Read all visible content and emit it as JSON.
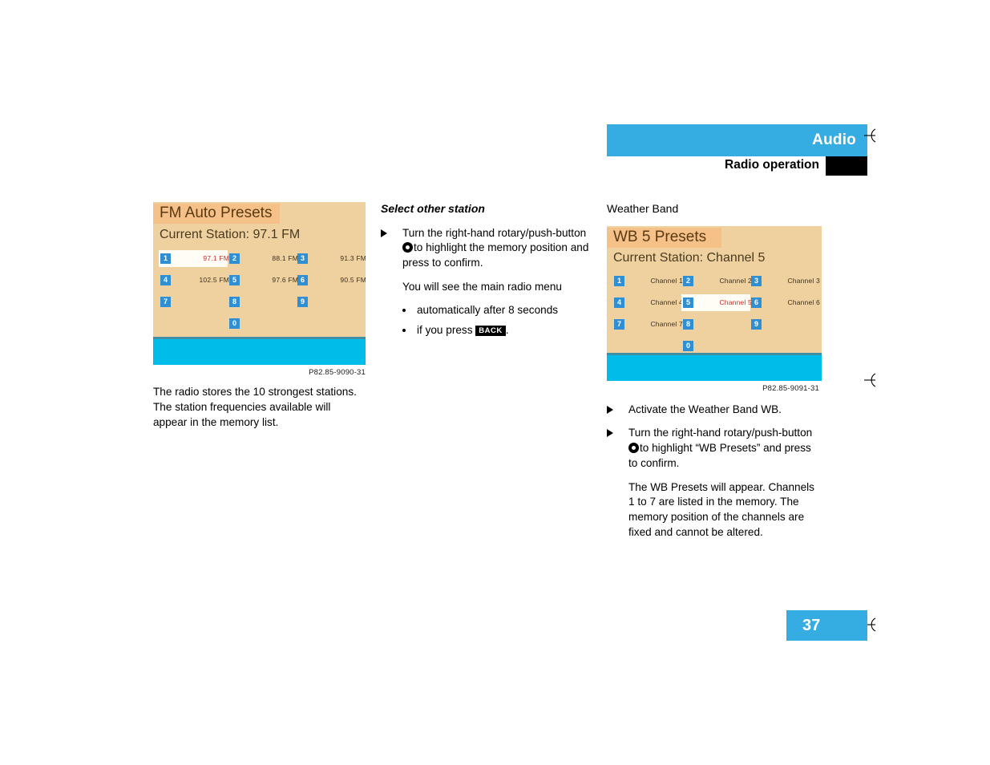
{
  "header": {
    "title": "Audio",
    "subtitle": "Radio operation",
    "accent_color": "#35ade3",
    "block_color": "#000000"
  },
  "page": {
    "number": "37",
    "number_box_color": "#35ade3"
  },
  "figures": {
    "fm": {
      "screen_title": "FM Auto Presets",
      "current_station_label": "Current Station: 97.1 FM",
      "caption": "P82.85-9090-31",
      "background_color": "#efd19f",
      "titlebar_color": "#f5c189",
      "footer_color": "#00bce8",
      "selected_color": "#c9302c",
      "presets": [
        {
          "num": "1",
          "value": "97.1 FM",
          "selected": true
        },
        {
          "num": "2",
          "value": "88.1 FM",
          "selected": false
        },
        {
          "num": "3",
          "value": "91.3 FM",
          "selected": false
        },
        {
          "num": "4",
          "value": "102.5 FM",
          "selected": false
        },
        {
          "num": "5",
          "value": "97.6 FM",
          "selected": false
        },
        {
          "num": "6",
          "value": "90.5 FM",
          "selected": false
        },
        {
          "num": "7",
          "value": "",
          "selected": false
        },
        {
          "num": "8",
          "value": "",
          "selected": false
        },
        {
          "num": "9",
          "value": "",
          "selected": false
        },
        {
          "num": "0",
          "value": "",
          "selected": false
        }
      ]
    },
    "wb": {
      "screen_title": "WB 5 Presets",
      "current_station_label": "Current Station: Channel 5",
      "caption": "P82.85-9091-31",
      "background_color": "#efd19f",
      "titlebar_color": "#f5c189",
      "footer_color": "#00bce8",
      "selected_color": "#c9302c",
      "presets": [
        {
          "num": "1",
          "value": "Channel 1",
          "selected": false
        },
        {
          "num": "2",
          "value": "Channel 2",
          "selected": false
        },
        {
          "num": "3",
          "value": "Channel 3",
          "selected": false
        },
        {
          "num": "4",
          "value": "Channel 4",
          "selected": false
        },
        {
          "num": "5",
          "value": "Channel 5",
          "selected": true
        },
        {
          "num": "6",
          "value": "Channel 6",
          "selected": false
        },
        {
          "num": "7",
          "value": "Channel 7",
          "selected": false
        },
        {
          "num": "8",
          "value": "",
          "selected": false
        },
        {
          "num": "9",
          "value": "",
          "selected": false
        },
        {
          "num": "0",
          "value": "",
          "selected": false
        }
      ]
    }
  },
  "left_column": {
    "paragraph": "The radio stores the 10 strongest stations. The station frequencies available will appear in the memory list."
  },
  "middle_column": {
    "heading": "Select other station",
    "step_1_part_a": "Turn the right-hand rotary/push-button",
    "step_1_part_b": "to highlight the memory position and press to confirm.",
    "continuation": "You will see the main radio menu",
    "bullets": [
      {
        "text": "automatically after 8 seconds",
        "key": "",
        "tail": ""
      },
      {
        "text": "if you press ",
        "key": "BACK",
        "tail": "."
      }
    ]
  },
  "right_column": {
    "heading": "Weather Band",
    "step_1": "Activate the Weather Band WB.",
    "step_2_part_a": "Turn the right-hand rotary/push-button",
    "step_2_part_b": "to highlight “WB Presets” and press to confirm.",
    "paragraph": "The WB Presets will appear. Channels 1 to 7 are listed in the memory. The memory position of the channels are fixed and cannot be altered."
  }
}
